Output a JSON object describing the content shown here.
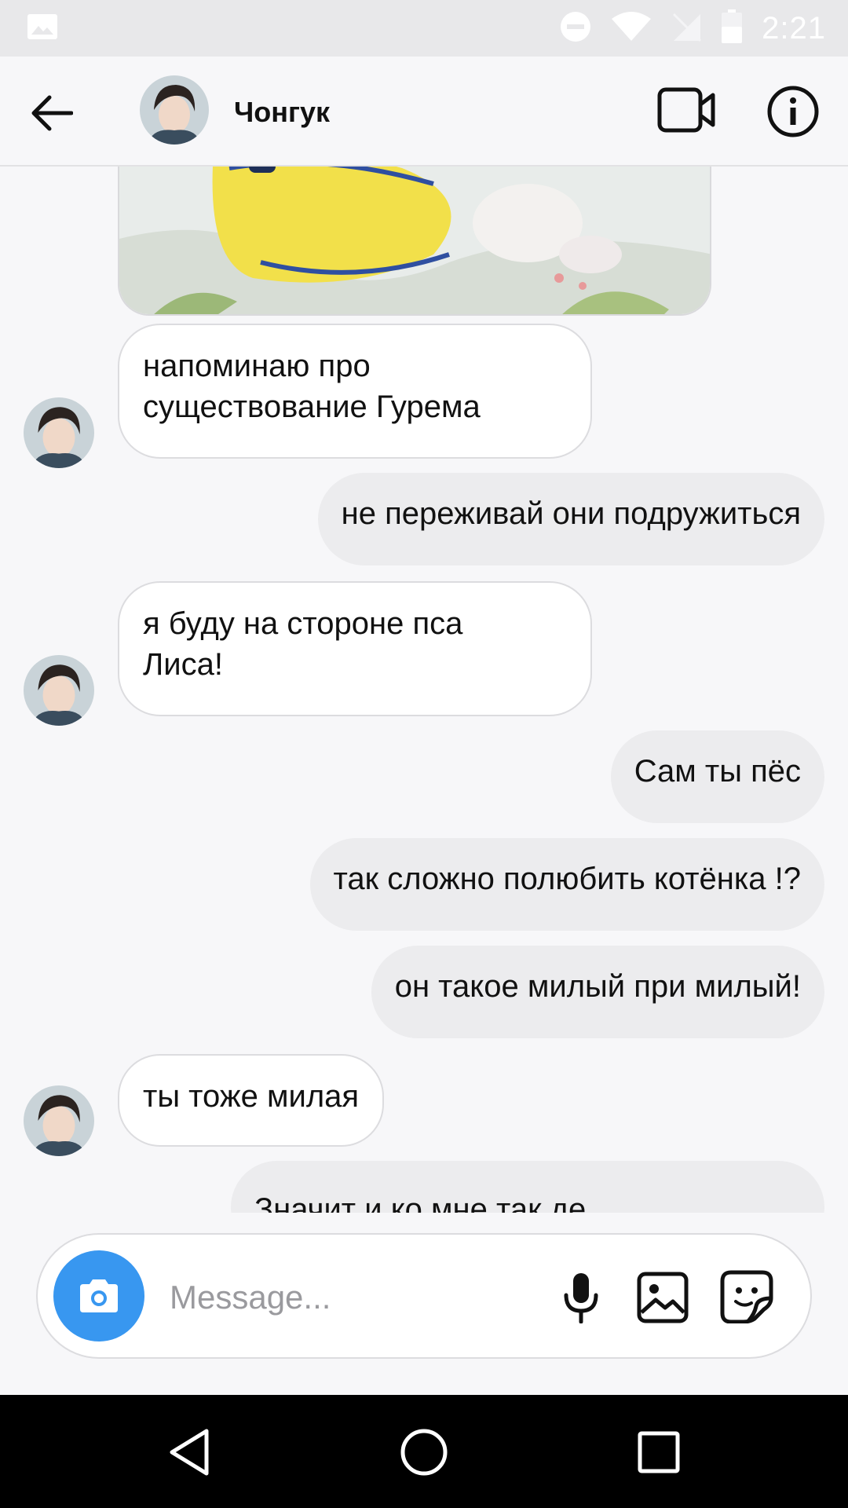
{
  "status_bar": {
    "time": "2:21",
    "icons": [
      "image-notification-icon",
      "do-not-disturb-icon",
      "wifi-icon",
      "no-sim-icon",
      "battery-icon"
    ]
  },
  "header": {
    "contact_name": "Чонгук",
    "icons": [
      "back-arrow-icon",
      "video-call-icon",
      "info-icon"
    ]
  },
  "messages": [
    {
      "type": "photo",
      "direction": "incoming"
    },
    {
      "direction": "incoming",
      "text": "напоминаю про существование Гурема",
      "lines": [
        "напоминаю про",
        "существование Гурема"
      ]
    },
    {
      "direction": "outgoing",
      "text": "не переживай они подружиться"
    },
    {
      "direction": "incoming",
      "text": "я буду на стороне пса Лиса!",
      "lines": [
        "я буду на стороне пса",
        "Лиса!"
      ]
    },
    {
      "direction": "outgoing",
      "text": "Сам ты пёс"
    },
    {
      "direction": "outgoing",
      "text": "так сложно полюбить котёнка !?"
    },
    {
      "direction": "outgoing",
      "text": "он такое милый при милый!"
    },
    {
      "direction": "incoming",
      "text": "ты тоже милая"
    },
    {
      "direction": "outgoing",
      "text": "Значит и ко мне так де"
    }
  ],
  "composer": {
    "placeholder": "Message...",
    "value": "",
    "icons": [
      "camera-icon",
      "microphone-icon",
      "gallery-icon",
      "sticker-icon"
    ]
  },
  "colors": {
    "accent": "#3897f0",
    "background": "#f7f7f9",
    "outgoing_bubble": "#ececee",
    "incoming_bubble": "#ffffff",
    "status_bar": "#e8e8ea",
    "nav_bar": "#000000"
  },
  "nav_bar": {
    "icons": [
      "nav-back-icon",
      "nav-home-icon",
      "nav-recents-icon"
    ]
  }
}
